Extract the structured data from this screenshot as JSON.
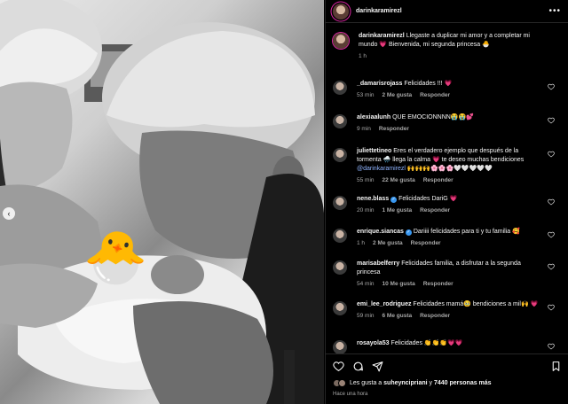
{
  "post": {
    "username": "darinkaramirezl",
    "caption_user": "darinkaramirezl",
    "caption_text": "Llegaste a duplicar mi amor y a completar mi mundo 💗 Bienvenida, mi segunda princesa 🐣",
    "caption_time": "1 h",
    "sticker": "🐣"
  },
  "comments": [
    {
      "user": "_damarisrojass",
      "text": "Felicidades !!! 💗",
      "time": "53 min",
      "likes": "2 Me gusta",
      "reply": "Responder"
    },
    {
      "user": "alexiaalunh",
      "text": "QUE EMOCIONNNN😭😭💕",
      "time": "9 min",
      "likes": "",
      "reply": "Responder"
    },
    {
      "user": "juliettetineo",
      "text": "Eres el verdadero ejemplo que después de la tormenta 🌧️ llega la calma 💗 te deseo muchas bendiciones",
      "mention": "@darinkaramirezl",
      "tail": "🙌🙌🙌🌸🌸🌸🤍🤍🤍🤍🤍",
      "time": "55 min",
      "likes": "22 Me gusta",
      "reply": "Responder"
    },
    {
      "user": "nene.blass",
      "verified": true,
      "text": "Felicidades DariG 💗",
      "time": "20 min",
      "likes": "1 Me gusta",
      "reply": "Responder"
    },
    {
      "user": "enrique.siancas",
      "verified": true,
      "text": "Dariiii felicidades para ti y tu familia 🥰",
      "time": "1 h",
      "likes": "2 Me gusta",
      "reply": "Responder"
    },
    {
      "user": "marisabelferry",
      "text": "Felicidades familia, a disfrutar a la segunda princesa",
      "time": "54 min",
      "likes": "10 Me gusta",
      "reply": "Responder"
    },
    {
      "user": "emi_lee_rodriguez",
      "text": "Felicidades mamá🥹 bendiciones a mil🙌 💗",
      "time": "59 min",
      "likes": "6 Me gusta",
      "reply": "Responder"
    },
    {
      "user": "rosayola53",
      "text": "Felicidades 👏👏👏💗💗",
      "time": "",
      "likes": "",
      "reply": ""
    }
  ],
  "likes": {
    "prefix": "Les gusta a",
    "user": "suheyncipriani",
    "middle": "y",
    "count": "7440 personas más"
  },
  "posted": "Hace una hora",
  "nav_arrow": "‹",
  "more_icon": "•••",
  "icons": [
    "heart-icon",
    "comment-icon",
    "share-icon",
    "bookmark-icon"
  ],
  "colors": {
    "accent": "#ffffff",
    "link": "#8fb4ff",
    "muted": "#a8a8a8",
    "verified": "#3897f0"
  }
}
